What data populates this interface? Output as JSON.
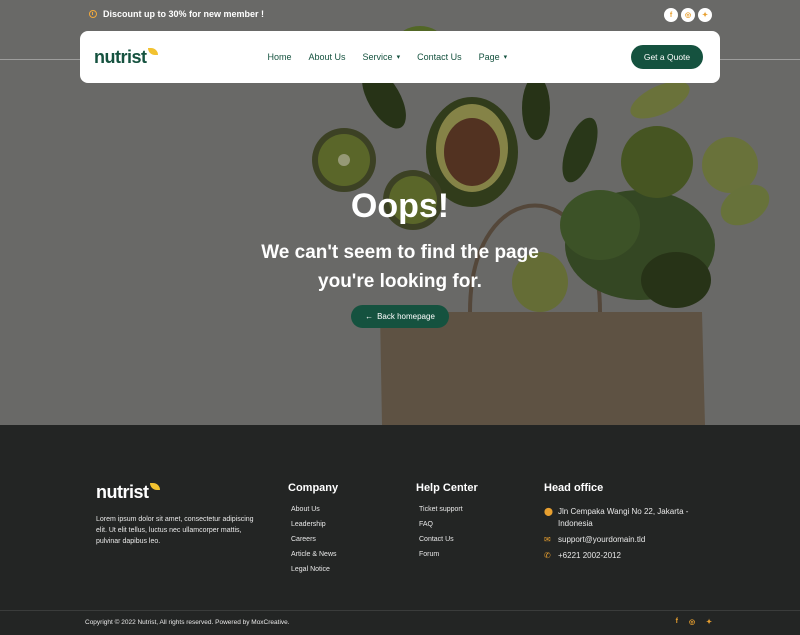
{
  "topbar": {
    "promo_text": "Discount up to 30% for new member !",
    "social": [
      {
        "icon": "facebook-icon",
        "glyph": "f"
      },
      {
        "icon": "instagram-icon",
        "glyph": "◎"
      },
      {
        "icon": "twitter-icon",
        "glyph": "✦"
      }
    ]
  },
  "nav": {
    "logo": "nutrist",
    "items": [
      {
        "label": "Home",
        "dropdown": false
      },
      {
        "label": "About Us",
        "dropdown": false
      },
      {
        "label": "Service",
        "dropdown": true
      },
      {
        "label": "Contact Us",
        "dropdown": false
      },
      {
        "label": "Page",
        "dropdown": true
      }
    ],
    "cta": "Get a Quote"
  },
  "hero": {
    "title": "Oops!",
    "subtitle": "We can't seem to find the page you're looking for.",
    "button": "Back homepage"
  },
  "footer": {
    "logo": "nutrist",
    "about": "Lorem ipsum dolor sit amet, consectetur adipiscing elit. Ut elit tellus, luctus nec ullamcorper mattis, pulvinar dapibus leo.",
    "company": {
      "title": "Company",
      "links": [
        "About Us",
        "Leadership",
        "Careers",
        "Article & News",
        "Legal Notice"
      ]
    },
    "help": {
      "title": "Help Center",
      "links": [
        "Ticket support",
        "FAQ",
        "Contact Us",
        "Forum"
      ]
    },
    "office": {
      "title": "Head office",
      "address": "Jln Cempaka Wangi No 22, Jakarta - Indonesia",
      "email": "support@yourdomain.tld",
      "phone": "+6221 2002-2012"
    },
    "copyright": "Copyright © 2022 Nutrist, All rights reserved. Powered by MoxCreative."
  },
  "colors": {
    "brand": "#15523f",
    "accent": "#e8a030",
    "footer_bg": "#232524"
  }
}
